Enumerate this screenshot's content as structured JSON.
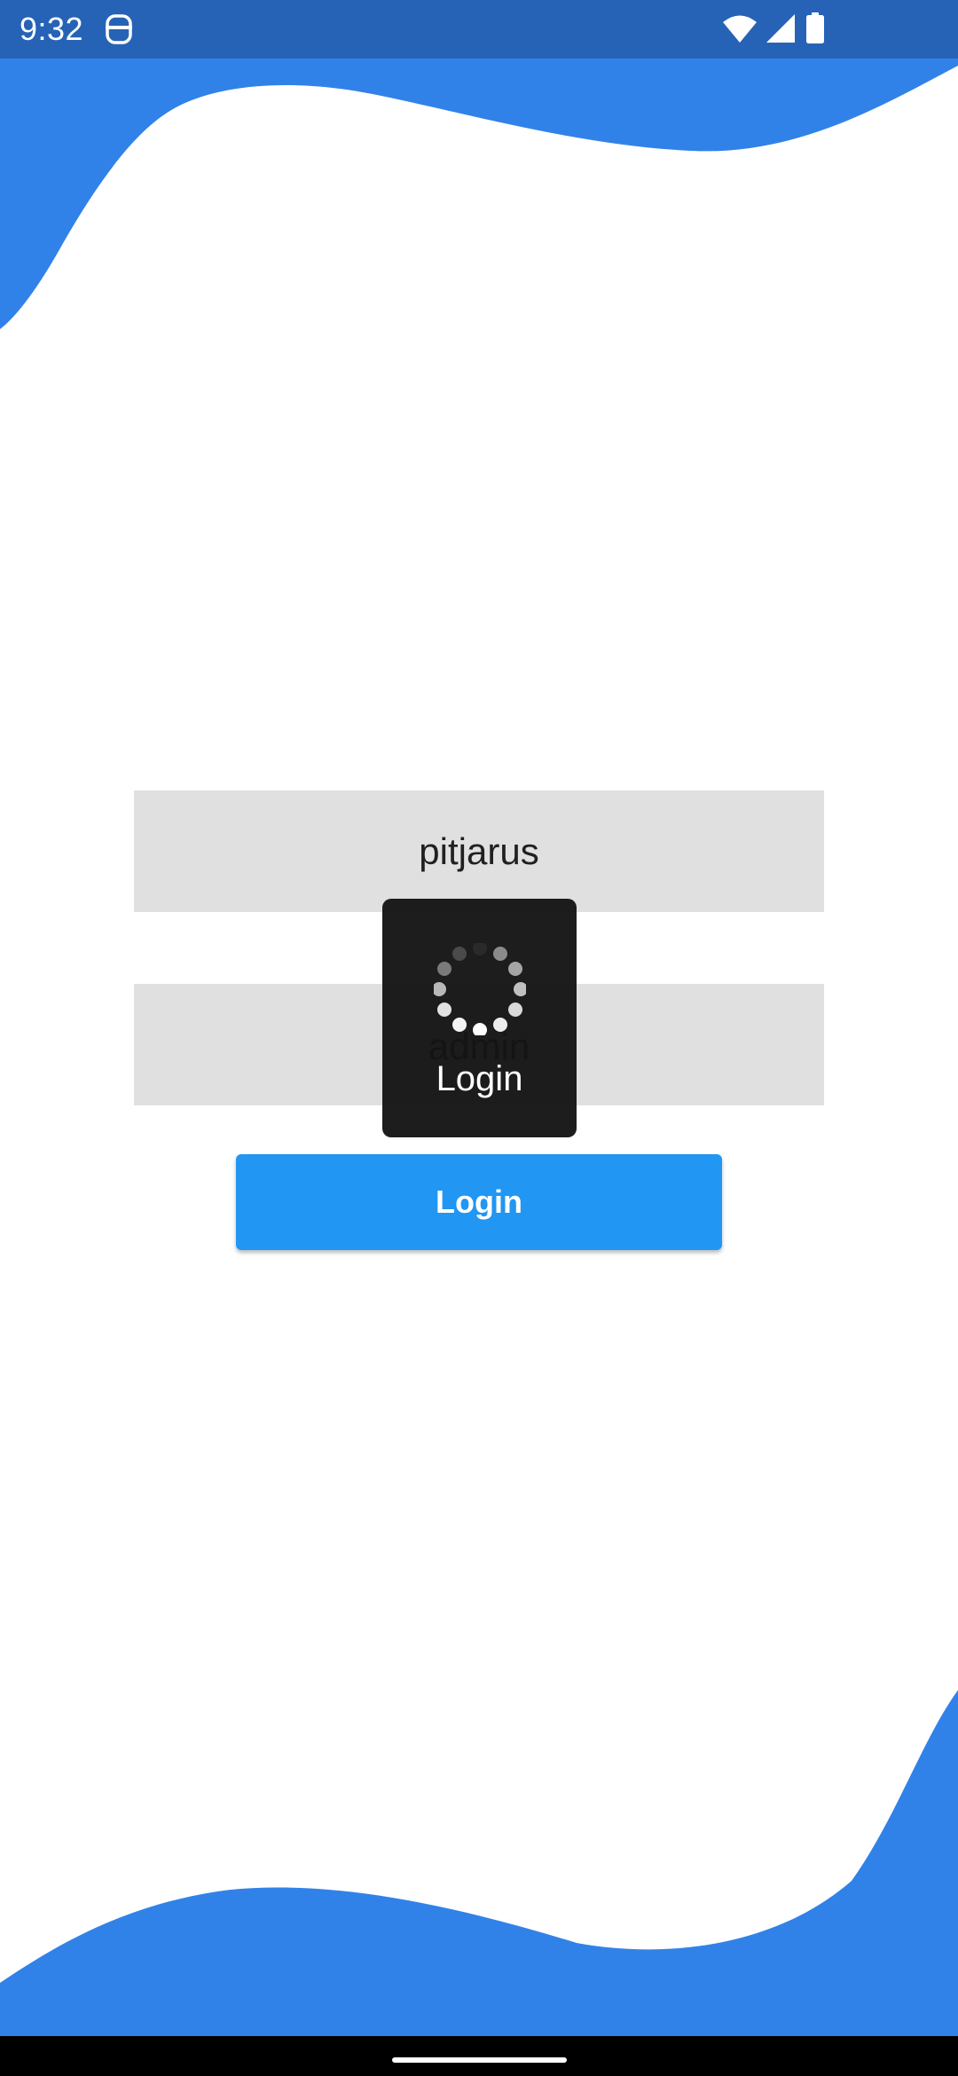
{
  "status_bar": {
    "time": "9:32",
    "icons": [
      "app-notification-icon",
      "wifi-icon",
      "cellular-signal-icon",
      "battery-icon"
    ]
  },
  "login_form": {
    "username_value": "pitjarus",
    "password_value": "admin",
    "login_button_label": "Login"
  },
  "loading_dialog": {
    "label": "Login",
    "icon": "loading-spinner-icon"
  },
  "colors": {
    "status_bar": "#2663B6",
    "wave": "#3182E8",
    "field_background": "#E0E0E0",
    "button": "#2196F3",
    "dialog_background": "#141414"
  }
}
